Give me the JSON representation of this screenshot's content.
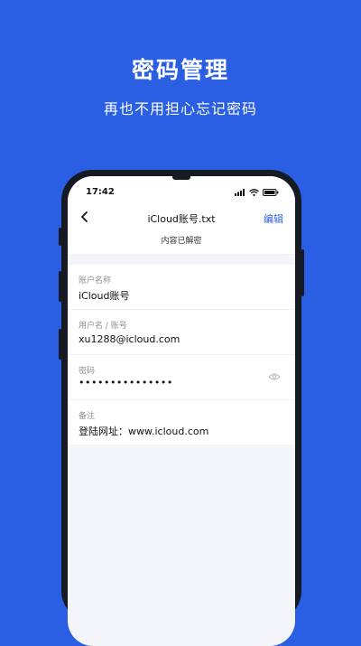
{
  "promo": {
    "headline": "密码管理",
    "subline": "再也不用担心忘记密码"
  },
  "status": {
    "time": "17:42",
    "icons": [
      "signal-icon",
      "wifi-icon",
      "battery-icon"
    ]
  },
  "nav": {
    "back_icon": "chevron-left-icon",
    "title": "iCloud账号.txt",
    "edit_label": "编辑",
    "subtitle": "内容已解密"
  },
  "fields": [
    {
      "label": "账户名称",
      "value": "iCloud账号"
    },
    {
      "label": "用户名 / 账号",
      "value": "xu1288@icloud.com"
    },
    {
      "label": "密码",
      "value": "•••••••••••••••",
      "masked": true,
      "icon": "eye-icon"
    },
    {
      "label": "备注",
      "value": "登陆网址：www.icloud.com"
    }
  ],
  "colors": {
    "background": "#2a5fe3",
    "accent": "#2a5fe3",
    "phone_frame": "#161a22",
    "screen_bg": "#f4f5f8"
  }
}
